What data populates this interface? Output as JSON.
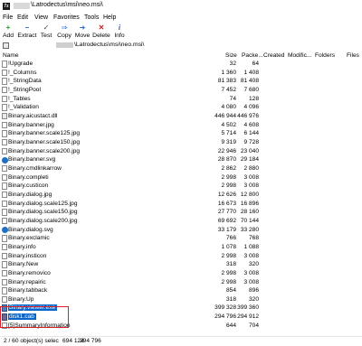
{
  "window": {
    "title": "\\Latrodectus\\msi\\neo.msi\\"
  },
  "menu": [
    "File",
    "Edit",
    "View",
    "Favorites",
    "Tools",
    "Help"
  ],
  "toolbar": [
    {
      "label": "Add",
      "icon": "plus-icon",
      "color": "#1f9d2a",
      "glyph": "+"
    },
    {
      "label": "Extract",
      "icon": "minus-icon",
      "color": "#2563c7",
      "glyph": "−"
    },
    {
      "label": "Test",
      "icon": "check-icon",
      "color": "#444444",
      "glyph": "✓"
    },
    {
      "label": "Copy",
      "icon": "copy-icon",
      "color": "#2b6fd6",
      "glyph": "⇒"
    },
    {
      "label": "Move",
      "icon": "move-icon",
      "color": "#2b6fd6",
      "glyph": "➜"
    },
    {
      "label": "Delete",
      "icon": "delete-icon",
      "color": "#d02020",
      "glyph": "✕"
    },
    {
      "label": "Info",
      "icon": "info-icon",
      "color": "#3b4fb0",
      "glyph": "i"
    }
  ],
  "address": {
    "path": "\\Latrodectus\\msi\\neo.msi\\"
  },
  "columns": [
    "Name",
    "Size",
    "Packe...",
    "Created",
    "Modific...",
    "Folders",
    "Files"
  ],
  "files": [
    {
      "name": "!Upgrade",
      "size": "32",
      "packed": "64",
      "type": "file"
    },
    {
      "name": "!_Columns",
      "size": "1 360",
      "packed": "1 408",
      "type": "file"
    },
    {
      "name": "!_StringData",
      "size": "81 383",
      "packed": "81 408",
      "type": "file"
    },
    {
      "name": "!_StringPool",
      "size": "7 452",
      "packed": "7 680",
      "type": "file"
    },
    {
      "name": "!_Tables",
      "size": "74",
      "packed": "128",
      "type": "file"
    },
    {
      "name": "!_Validation",
      "size": "4 080",
      "packed": "4 096",
      "type": "file"
    },
    {
      "name": "Binary.aicustact.dll",
      "size": "446 944",
      "packed": "446 976",
      "type": "dll"
    },
    {
      "name": "Binary.banner.jpg",
      "size": "4 502",
      "packed": "4 608",
      "type": "file"
    },
    {
      "name": "Binary.banner.scale125.jpg",
      "size": "5 714",
      "packed": "6 144",
      "type": "file"
    },
    {
      "name": "Binary.banner.scale150.jpg",
      "size": "9 319",
      "packed": "9 728",
      "type": "file"
    },
    {
      "name": "Binary.banner.scale200.jpg",
      "size": "22 946",
      "packed": "23 040",
      "type": "file"
    },
    {
      "name": "Binary.banner.svg",
      "size": "28 870",
      "packed": "29 184",
      "type": "svg"
    },
    {
      "name": "Binary.cmdlinkarrow",
      "size": "2 862",
      "packed": "2 880",
      "type": "file"
    },
    {
      "name": "Binary.completi",
      "size": "2 998",
      "packed": "3 008",
      "type": "file"
    },
    {
      "name": "Binary.custicon",
      "size": "2 998",
      "packed": "3 008",
      "type": "file"
    },
    {
      "name": "Binary.dialog.jpg",
      "size": "12 626",
      "packed": "12 800",
      "type": "file"
    },
    {
      "name": "Binary.dialog.scale125.jpg",
      "size": "16 673",
      "packed": "16 896",
      "type": "file"
    },
    {
      "name": "Binary.dialog.scale150.jpg",
      "size": "27 770",
      "packed": "28 160",
      "type": "file"
    },
    {
      "name": "Binary.dialog.scale200.jpg",
      "size": "69 692",
      "packed": "70 144",
      "type": "file"
    },
    {
      "name": "Binary.dialog.svg",
      "size": "33 179",
      "packed": "33 280",
      "type": "svg"
    },
    {
      "name": "Binary.exclamic",
      "size": "766",
      "packed": "768",
      "type": "file"
    },
    {
      "name": "Binary.info",
      "size": "1 078",
      "packed": "1 088",
      "type": "file"
    },
    {
      "name": "Binary.insticon",
      "size": "2 998",
      "packed": "3 008",
      "type": "file"
    },
    {
      "name": "Binary.New",
      "size": "318",
      "packed": "320",
      "type": "file"
    },
    {
      "name": "Binary.removico",
      "size": "2 998",
      "packed": "3 008",
      "type": "file"
    },
    {
      "name": "Binary.repairic",
      "size": "2 998",
      "packed": "3 008",
      "type": "file"
    },
    {
      "name": "Binary.tabback",
      "size": "854",
      "packed": "896",
      "type": "file"
    },
    {
      "name": "Binary.Up",
      "size": "318",
      "packed": "320",
      "type": "file"
    },
    {
      "name": "Binary.viewer.exe",
      "size": "399 328",
      "packed": "399 360",
      "type": "exe",
      "selected": true
    },
    {
      "name": "disk1.cab",
      "size": "294 796",
      "packed": "294 912",
      "type": "cab",
      "selected": true
    },
    {
      "name": "[5]SummaryInformation",
      "size": "644",
      "packed": "704",
      "type": "file"
    }
  ],
  "status": {
    "selection": "2 / 60 object(s) selec",
    "size_selected": "694 124",
    "size_total": "294 796"
  }
}
